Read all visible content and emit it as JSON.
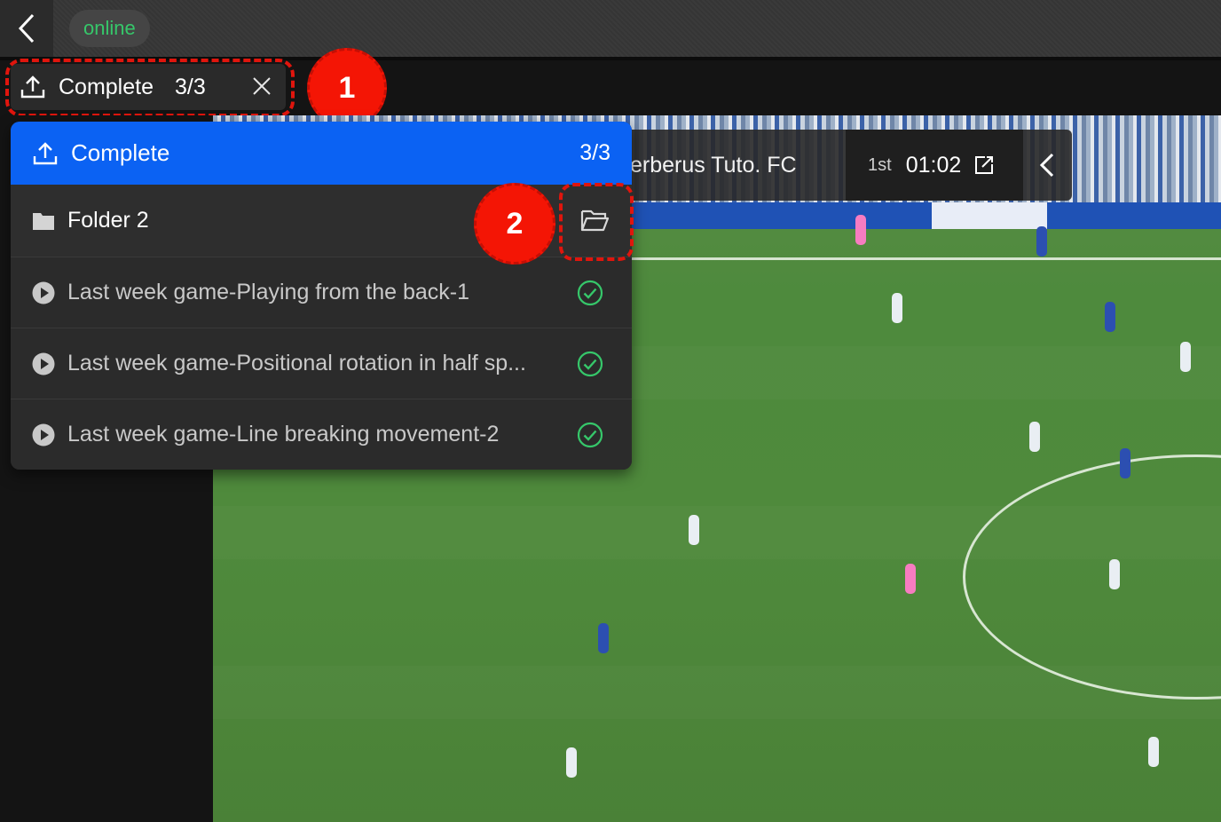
{
  "app": {
    "status": "online"
  },
  "upload_chip": {
    "label": "Complete",
    "count": "3/3"
  },
  "annotations": {
    "badge_1": "1",
    "badge_2": "2"
  },
  "dropdown": {
    "header": {
      "label": "Complete",
      "count": "3/3"
    },
    "folder": {
      "label": "Folder 2"
    },
    "items": [
      {
        "label": "Last week game-Playing from the back-1",
        "status": "complete"
      },
      {
        "label": "Last week game-Positional rotation in half sp...",
        "status": "complete"
      },
      {
        "label": "Last week game-Line breaking movement-2",
        "status": "complete"
      }
    ]
  },
  "scoreboard": {
    "team": "erberus Tuto. FC",
    "half": "1st",
    "clock": "01:02"
  },
  "colors": {
    "accent_blue": "#0b62f3",
    "online_green": "#36c76a",
    "success_green": "#36c76a",
    "annotation_red": "#f41505"
  },
  "icons": {
    "back": "chevron-left-icon",
    "upload": "upload-icon",
    "close": "close-icon",
    "folder": "folder-icon",
    "open_folder": "folder-open-icon",
    "play": "play-circle-icon",
    "check": "check-circle-icon",
    "edit": "edit-icon",
    "prev": "chevron-left-icon"
  }
}
